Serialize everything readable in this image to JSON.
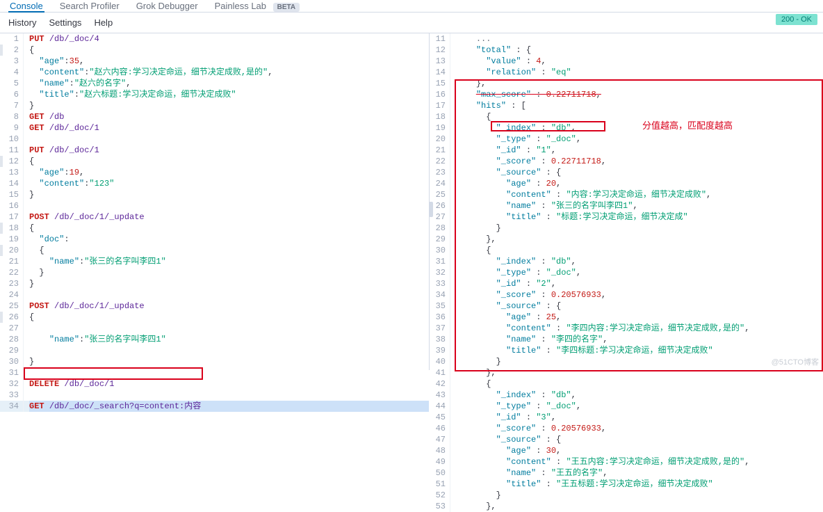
{
  "topTabs": {
    "console": "Console",
    "searchProfiler": "Search Profiler",
    "grokDebugger": "Grok Debugger",
    "painlessLab": "Painless Lab",
    "betaBadge": "BETA"
  },
  "subbar": {
    "history": "History",
    "settings": "Settings",
    "help": "Help"
  },
  "status": "200 - OK",
  "annotation": "分值越高，匹配度越高",
  "watermark": "@51CTO博客",
  "editor": {
    "lines": [
      {
        "n": 1,
        "html": "<span class='method'>PUT</span> <span class='path'>/db/_doc/4</span>"
      },
      {
        "n": 2,
        "html": "<span class='brace'>{</span>"
      },
      {
        "n": 3,
        "html": "  <span class='key'>\"age\"</span>:<span class='num-v'>35</span>,"
      },
      {
        "n": 4,
        "html": "  <span class='key'>\"content\"</span>:<span class='str'>\"赵六内容:学习决定命运，细节决定成败,是的\"</span>,"
      },
      {
        "n": 5,
        "html": "  <span class='key'>\"name\"</span>:<span class='str'>\"赵六的名字\"</span>,"
      },
      {
        "n": 6,
        "html": "  <span class='key'>\"title\"</span>:<span class='str'>\"赵六标题:学习决定命运，细节决定成败\"</span>"
      },
      {
        "n": 7,
        "html": "<span class='brace'>}</span>"
      },
      {
        "n": 8,
        "html": "<span class='method'>GET</span> <span class='path'>/db</span>"
      },
      {
        "n": 9,
        "html": "<span class='method'>GET</span> <span class='path'>/db/_doc/1</span>"
      },
      {
        "n": 10,
        "html": ""
      },
      {
        "n": 11,
        "html": "<span class='method'>PUT</span> <span class='path'>/db/_doc/1</span>"
      },
      {
        "n": 12,
        "html": "<span class='brace'>{</span>"
      },
      {
        "n": 13,
        "html": "  <span class='key'>\"age\"</span>:<span class='num-v'>19</span>,"
      },
      {
        "n": 14,
        "html": "  <span class='key'>\"content\"</span>:<span class='str'>\"123\"</span>"
      },
      {
        "n": 15,
        "html": "<span class='brace'>}</span>"
      },
      {
        "n": 16,
        "html": ""
      },
      {
        "n": 17,
        "html": "<span class='method'>POST</span> <span class='path'>/db/_doc/1/_update</span>"
      },
      {
        "n": 18,
        "html": "<span class='brace'>{</span>"
      },
      {
        "n": 19,
        "html": "  <span class='key'>\"doc\"</span>:"
      },
      {
        "n": 20,
        "html": "  <span class='brace'>{</span>"
      },
      {
        "n": 21,
        "html": "    <span class='key'>\"name\"</span>:<span class='str'>\"张三的名字叫李四1\"</span>"
      },
      {
        "n": 22,
        "html": "  <span class='brace'>}</span>"
      },
      {
        "n": 23,
        "html": "<span class='brace'>}</span>"
      },
      {
        "n": 24,
        "html": ""
      },
      {
        "n": 25,
        "html": "<span class='method'>POST</span> <span class='path'>/db/_doc/1/_update</span>"
      },
      {
        "n": 26,
        "html": "<span class='brace'>{</span>"
      },
      {
        "n": 27,
        "html": ""
      },
      {
        "n": 28,
        "html": "    <span class='key'>\"name\"</span>:<span class='str'>\"张三的名字叫李四1\"</span>"
      },
      {
        "n": 29,
        "html": ""
      },
      {
        "n": 30,
        "html": "<span class='brace'>}</span>"
      },
      {
        "n": 31,
        "html": ""
      },
      {
        "n": 32,
        "html": "<span class='method'>DELETE</span> <span class='path'>/db/_doc/1</span>"
      },
      {
        "n": 33,
        "html": ""
      },
      {
        "n": 34,
        "sel": true,
        "html": "<span class='method'>GET</span> <span class='path'>/db/_doc/_search?q=content:内容</span>"
      }
    ]
  },
  "response": {
    "lines": [
      {
        "n": 11,
        "html": "    <span class='comment'>...</span>"
      },
      {
        "n": 12,
        "html": "    <span class='key'>\"total\"</span> : <span class='brace'>{</span>"
      },
      {
        "n": 13,
        "html": "      <span class='key'>\"value\"</span> : <span class='num-v'>4</span>,"
      },
      {
        "n": 14,
        "html": "      <span class='key'>\"relation\"</span> : <span class='str'>\"eq\"</span>"
      },
      {
        "n": 15,
        "html": "    <span class='brace'>}</span>,"
      },
      {
        "n": 16,
        "html": "    <span class='key strike'>\"max_score\"</span><span class='strike'> : </span><span class='num-v strike'>0.22711718</span><span class='strike'>,</span>"
      },
      {
        "n": 17,
        "html": "    <span class='key'>\"hits\"</span> : <span class='brace'>[</span>"
      },
      {
        "n": 18,
        "html": "      <span class='brace'>{</span>"
      },
      {
        "n": 19,
        "html": "        <span class='key'>\"_index\"</span> : <span class='str'>\"db\"</span>,"
      },
      {
        "n": 20,
        "html": "        <span class='key'>\"_type\"</span> : <span class='str'>\"_doc\"</span>,"
      },
      {
        "n": 21,
        "html": "        <span class='key'>\"_id\"</span> : <span class='str'>\"1\"</span>,"
      },
      {
        "n": 22,
        "html": "        <span class='key'>\"_score\"</span> : <span class='num-v'>0.22711718</span>,"
      },
      {
        "n": 23,
        "html": "        <span class='key'>\"_source\"</span> : <span class='brace'>{</span>"
      },
      {
        "n": 24,
        "html": "          <span class='key'>\"age\"</span> : <span class='num-v'>20</span>,"
      },
      {
        "n": 25,
        "html": "          <span class='key'>\"content\"</span> : <span class='str'>\"内容:学习决定命运，细节决定成败\"</span>,"
      },
      {
        "n": 26,
        "html": "          <span class='key'>\"name\"</span> : <span class='str'>\"张三的名字叫李四1\"</span>,"
      },
      {
        "n": 27,
        "html": "          <span class='key'>\"title\"</span> : <span class='str'>\"标题:学习决定命运，细节决定成\"</span>"
      },
      {
        "n": 28,
        "html": "        <span class='brace'>}</span>"
      },
      {
        "n": 29,
        "html": "      <span class='brace'>}</span>,"
      },
      {
        "n": 30,
        "html": "      <span class='brace'>{</span>"
      },
      {
        "n": 31,
        "html": "        <span class='key'>\"_index\"</span> : <span class='str'>\"db\"</span>,"
      },
      {
        "n": 32,
        "html": "        <span class='key'>\"_type\"</span> : <span class='str'>\"_doc\"</span>,"
      },
      {
        "n": 33,
        "html": "        <span class='key'>\"_id\"</span> : <span class='str'>\"2\"</span>,"
      },
      {
        "n": 34,
        "html": "        <span class='key'>\"_score\"</span> : <span class='num-v'>0.20576933</span>,"
      },
      {
        "n": 35,
        "html": "        <span class='key'>\"_source\"</span> : <span class='brace'>{</span>"
      },
      {
        "n": 36,
        "html": "          <span class='key'>\"age\"</span> : <span class='num-v'>25</span>,"
      },
      {
        "n": 37,
        "html": "          <span class='key'>\"content\"</span> : <span class='str'>\"李四内容:学习决定命运，细节决定成败,是的\"</span>,"
      },
      {
        "n": 38,
        "html": "          <span class='key'>\"name\"</span> : <span class='str'>\"李四的名字\"</span>,"
      },
      {
        "n": 39,
        "html": "          <span class='key'>\"title\"</span> : <span class='str'>\"李四标题:学习决定命运，细节决定成败\"</span>"
      },
      {
        "n": 40,
        "html": "        <span class='brace'>}</span>"
      },
      {
        "n": 41,
        "html": "      <span class='brace'>}</span>,"
      },
      {
        "n": 42,
        "html": "      <span class='brace'>{</span>"
      },
      {
        "n": 43,
        "html": "        <span class='key'>\"_index\"</span> : <span class='str'>\"db\"</span>,"
      },
      {
        "n": 44,
        "html": "        <span class='key'>\"_type\"</span> : <span class='str'>\"_doc\"</span>,"
      },
      {
        "n": 45,
        "html": "        <span class='key'>\"_id\"</span> : <span class='str'>\"3\"</span>,"
      },
      {
        "n": 46,
        "html": "        <span class='key'>\"_score\"</span> : <span class='num-v'>0.20576933</span>,"
      },
      {
        "n": 47,
        "html": "        <span class='key'>\"_source\"</span> : <span class='brace'>{</span>"
      },
      {
        "n": 48,
        "html": "          <span class='key'>\"age\"</span> : <span class='num-v'>30</span>,"
      },
      {
        "n": 49,
        "html": "          <span class='key'>\"content\"</span> : <span class='str'>\"王五内容:学习决定命运，细节决定成败,是的\"</span>,"
      },
      {
        "n": 50,
        "html": "          <span class='key'>\"name\"</span> : <span class='str'>\"王五的名字\"</span>,"
      },
      {
        "n": 51,
        "html": "          <span class='key'>\"title\"</span> : <span class='str'>\"王五标题:学习决定命运，细节决定成败\"</span>"
      },
      {
        "n": 52,
        "html": "        <span class='brace'>}</span>"
      },
      {
        "n": 53,
        "html": "      <span class='brace'>}</span>,"
      }
    ]
  }
}
